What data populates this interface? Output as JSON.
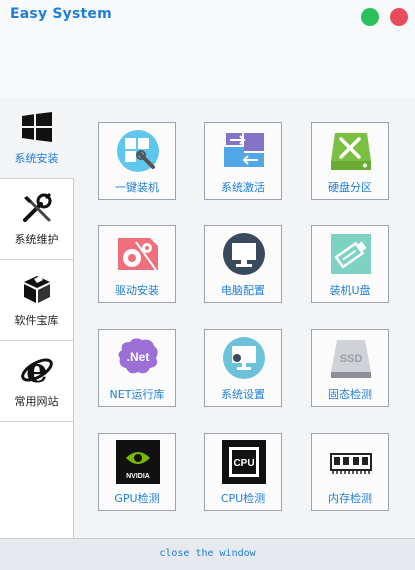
{
  "app": {
    "title": "Easy System"
  },
  "sidebar": {
    "items": [
      {
        "label": "系统安装",
        "icon": "windows-logo-icon",
        "active": true
      },
      {
        "label": "系统维护",
        "icon": "tools-wrench-screwdriver-icon",
        "active": false
      },
      {
        "label": "软件宝库",
        "icon": "software-box-icon",
        "active": false
      },
      {
        "label": "常用网站",
        "icon": "internet-explorer-icon",
        "active": false
      }
    ]
  },
  "tiles": [
    {
      "label": "一键装机",
      "icon": "one-click-install-icon"
    },
    {
      "label": "系统激活",
      "icon": "system-activate-icon"
    },
    {
      "label": "硬盘分区",
      "icon": "disk-partition-icon"
    },
    {
      "label": "驱动安装",
      "icon": "driver-install-icon"
    },
    {
      "label": "电脑配置",
      "icon": "computer-config-icon"
    },
    {
      "label": "装机U盘",
      "icon": "usb-install-icon"
    },
    {
      "label": "NET运行库",
      "icon": "dotnet-runtime-icon",
      "badge": ".Net"
    },
    {
      "label": "系统设置",
      "icon": "system-settings-icon"
    },
    {
      "label": "固态检测",
      "icon": "ssd-check-icon",
      "badge": "SSD"
    },
    {
      "label": "GPU检测",
      "icon": "gpu-check-icon",
      "badge": "NVIDIA"
    },
    {
      "label": "CPU检测",
      "icon": "cpu-check-icon",
      "badge": "CPU"
    },
    {
      "label": "内存检测",
      "icon": "memory-check-icon"
    }
  ],
  "footer": {
    "close_label": "close the window"
  },
  "colors": {
    "accent": "#1f7fd8",
    "minimize": "#29c25a",
    "close": "#e94b5f"
  }
}
